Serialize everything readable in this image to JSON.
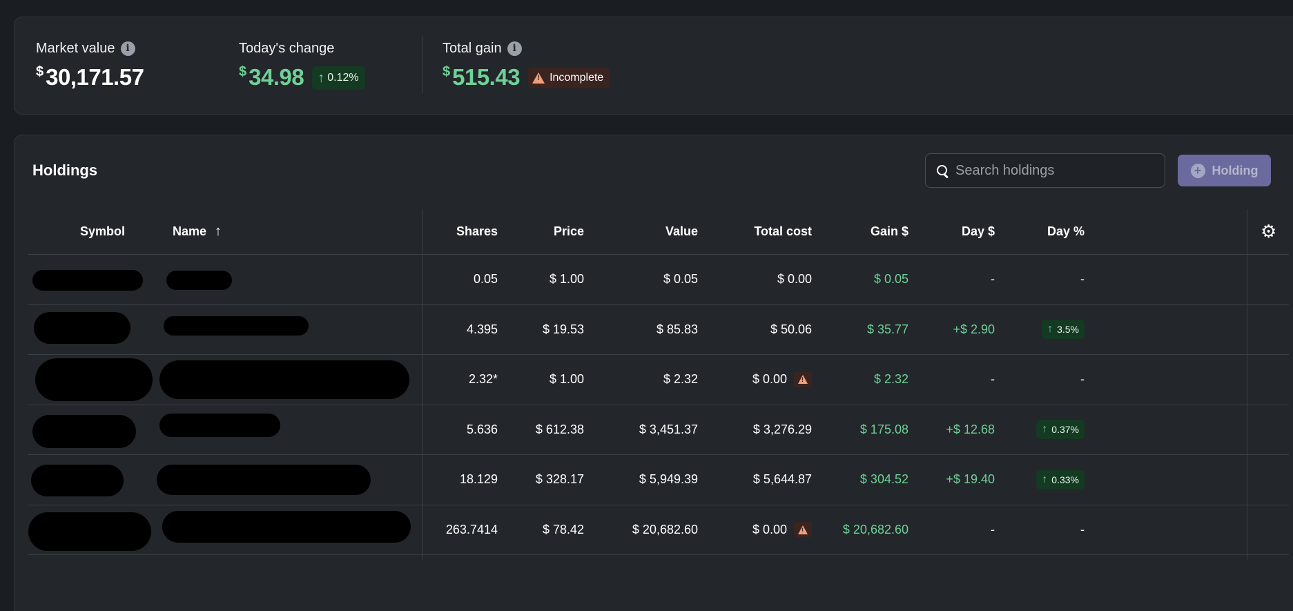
{
  "summary": {
    "market_value": {
      "label": "Market value",
      "currency": "$",
      "value": "30,171.57"
    },
    "todays_change": {
      "label": "Today's change",
      "currency": "$",
      "value": "34.98",
      "percent": "0.12%"
    },
    "total_gain": {
      "label": "Total gain",
      "currency": "$",
      "value": "515.43",
      "status": "Incomplete"
    }
  },
  "holdings": {
    "title": "Holdings",
    "search_placeholder": "Search holdings",
    "add_button_label": "Holding",
    "columns": {
      "symbol": "Symbol",
      "name": "Name",
      "shares": "Shares",
      "price": "Price",
      "value": "Value",
      "total_cost": "Total cost",
      "gain": "Gain $",
      "day_dollar": "Day $",
      "day_percent": "Day %"
    },
    "rows": [
      {
        "shares": "0.05",
        "price": "$ 1.00",
        "value": "$ 0.05",
        "total_cost": "$ 0.00",
        "gain": "$ 0.05",
        "day_dollar": "-",
        "day_percent": "-"
      },
      {
        "shares": "4.395",
        "price": "$ 19.53",
        "value": "$ 85.83",
        "total_cost": "$ 50.06",
        "gain": "$ 35.77",
        "day_dollar": "+$ 2.90",
        "day_percent": "3.5%"
      },
      {
        "shares": "2.32*",
        "price": "$ 1.00",
        "value": "$ 2.32",
        "total_cost": "$ 0.00",
        "gain": "$ 2.32",
        "day_dollar": "-",
        "day_percent": "-"
      },
      {
        "shares": "5.636",
        "price": "$ 612.38",
        "value": "$ 3,451.37",
        "total_cost": "$ 3,276.29",
        "gain": "$ 175.08",
        "day_dollar": "+$ 12.68",
        "day_percent": "0.37%"
      },
      {
        "shares": "18.129",
        "price": "$ 328.17",
        "value": "$ 5,949.39",
        "total_cost": "$ 5,644.87",
        "gain": "$ 304.52",
        "day_dollar": "+$ 19.40",
        "day_percent": "0.33%"
      },
      {
        "shares": "263.7414",
        "price": "$ 78.42",
        "value": "$ 20,682.60",
        "total_cost": "$ 0.00",
        "gain": "$ 20,682.60",
        "day_dollar": "-",
        "day_percent": "-"
      }
    ]
  }
}
